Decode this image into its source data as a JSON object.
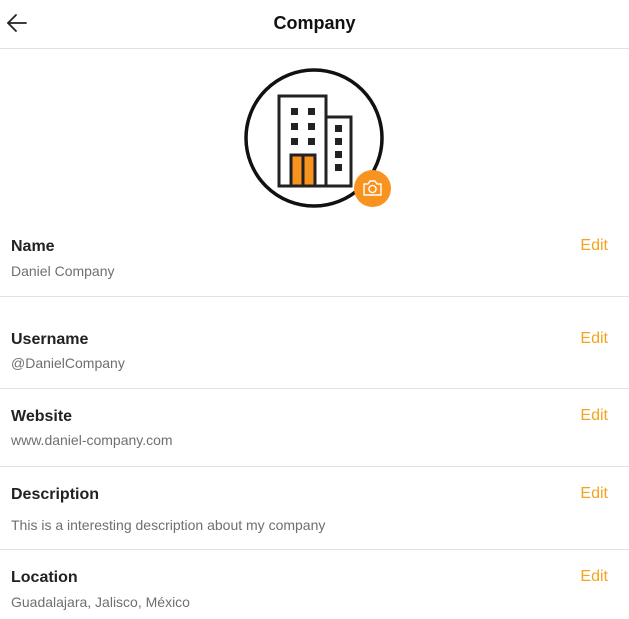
{
  "header": {
    "title": "Company"
  },
  "colors": {
    "accent": "#f7931e",
    "edit_text": "#f5a21e"
  },
  "icons": {
    "back": "arrow-left-icon",
    "avatar": "building-icon",
    "camera": "camera-icon"
  },
  "fields": [
    {
      "label": "Name",
      "value": "Daniel Company",
      "edit_label": "Edit"
    },
    {
      "label": "Username",
      "value": "@DanielCompany",
      "edit_label": "Edit"
    },
    {
      "label": "Website",
      "value": "www.daniel-company.com",
      "edit_label": "Edit"
    },
    {
      "label": "Description",
      "value": "This is a interesting description about my company",
      "edit_label": "Edit"
    },
    {
      "label": "Location",
      "value": "Guadalajara, Jalisco, México",
      "edit_label": "Edit"
    }
  ]
}
